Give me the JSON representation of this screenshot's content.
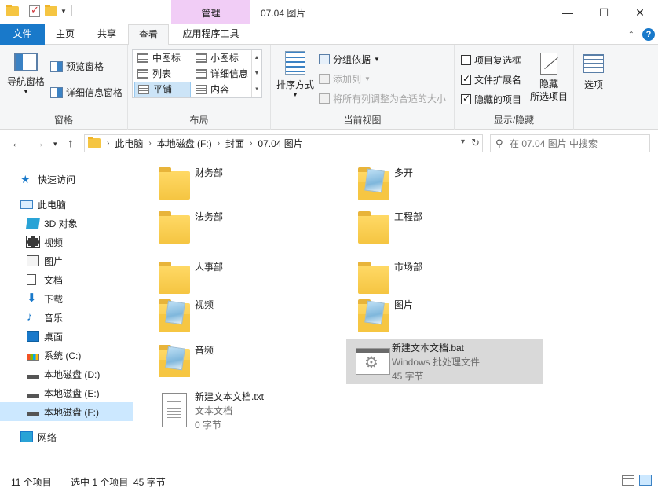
{
  "window": {
    "title": "07.04 图片",
    "context_tab_header": "管理",
    "controls": {
      "minimize": "—",
      "maximize": "☐",
      "close": "✕"
    }
  },
  "tabs": [
    "文件",
    "主页",
    "共享",
    "查看",
    "应用程序工具"
  ],
  "active_tab": "查看",
  "ribbon": {
    "panes": {
      "label": "窗格",
      "nav_pane": "导航窗格",
      "preview_pane": "预览窗格",
      "details_pane": "详细信息窗格"
    },
    "layout": {
      "label": "布局",
      "items": [
        "中图标",
        "小图标",
        "列表",
        "详细信息",
        "平铺",
        "内容"
      ],
      "selected": "平铺"
    },
    "current_view": {
      "label": "当前视图",
      "sort_by": "排序方式",
      "group_by": "分组依据",
      "add_columns": "添加列",
      "fit_columns": "将所有列调整为合适的大小"
    },
    "show_hide": {
      "label": "显示/隐藏",
      "item_checkboxes": {
        "label": "项目复选框",
        "checked": false
      },
      "file_extensions": {
        "label": "文件扩展名",
        "checked": true
      },
      "hidden_items": {
        "label": "隐藏的项目",
        "checked": true
      },
      "hide_selected": "隐藏\n所选项目"
    },
    "options": "选项"
  },
  "address": {
    "crumbs": [
      "此电脑",
      "本地磁盘 (F:)",
      "封面",
      "07.04 图片"
    ],
    "search_placeholder": "在 07.04 图片 中搜索"
  },
  "sidebar": {
    "items": [
      {
        "label": "快速访问",
        "icon": "star-icon"
      },
      {
        "label": "此电脑",
        "icon": "computer-icon"
      },
      {
        "label": "3D 对象",
        "icon": "3d-objects-icon"
      },
      {
        "label": "视频",
        "icon": "video-icon"
      },
      {
        "label": "图片",
        "icon": "pictures-icon"
      },
      {
        "label": "文档",
        "icon": "documents-icon"
      },
      {
        "label": "下载",
        "icon": "download-icon"
      },
      {
        "label": "音乐",
        "icon": "music-icon"
      },
      {
        "label": "桌面",
        "icon": "desktop-icon"
      },
      {
        "label": "系统 (C:)",
        "icon": "system-drive-icon"
      },
      {
        "label": "本地磁盘 (D:)",
        "icon": "drive-icon"
      },
      {
        "label": "本地磁盘 (E:)",
        "icon": "drive-icon"
      },
      {
        "label": "本地磁盘 (F:)",
        "icon": "drive-icon"
      },
      {
        "label": "网络",
        "icon": "network-icon"
      }
    ],
    "selected": "本地磁盘 (F:)"
  },
  "files": [
    {
      "name": "财务部",
      "type": "folder"
    },
    {
      "name": "多开",
      "type": "folder-lib"
    },
    {
      "name": "法务部",
      "type": "folder"
    },
    {
      "name": "工程部",
      "type": "folder"
    },
    {
      "name": "人事部",
      "type": "folder"
    },
    {
      "name": "市场部",
      "type": "folder"
    },
    {
      "name": "视频",
      "type": "folder-lib"
    },
    {
      "name": "图片",
      "type": "folder-lib"
    },
    {
      "name": "音频",
      "type": "folder-lib"
    },
    {
      "name": "新建文本文档.bat",
      "type": "bat",
      "line2": "Windows 批处理文件",
      "line3": "45 字节",
      "selected": true
    },
    {
      "name": "新建文本文档.txt",
      "type": "txt",
      "line2": "文本文档",
      "line3": "0 字节"
    }
  ],
  "status": {
    "item_count": "11 个项目",
    "selection": "选中 1 个项目  45 字节"
  },
  "colors": {
    "accent": "#1979ca",
    "context_tab": "#f1cdf6",
    "selection": "#cce8ff"
  }
}
